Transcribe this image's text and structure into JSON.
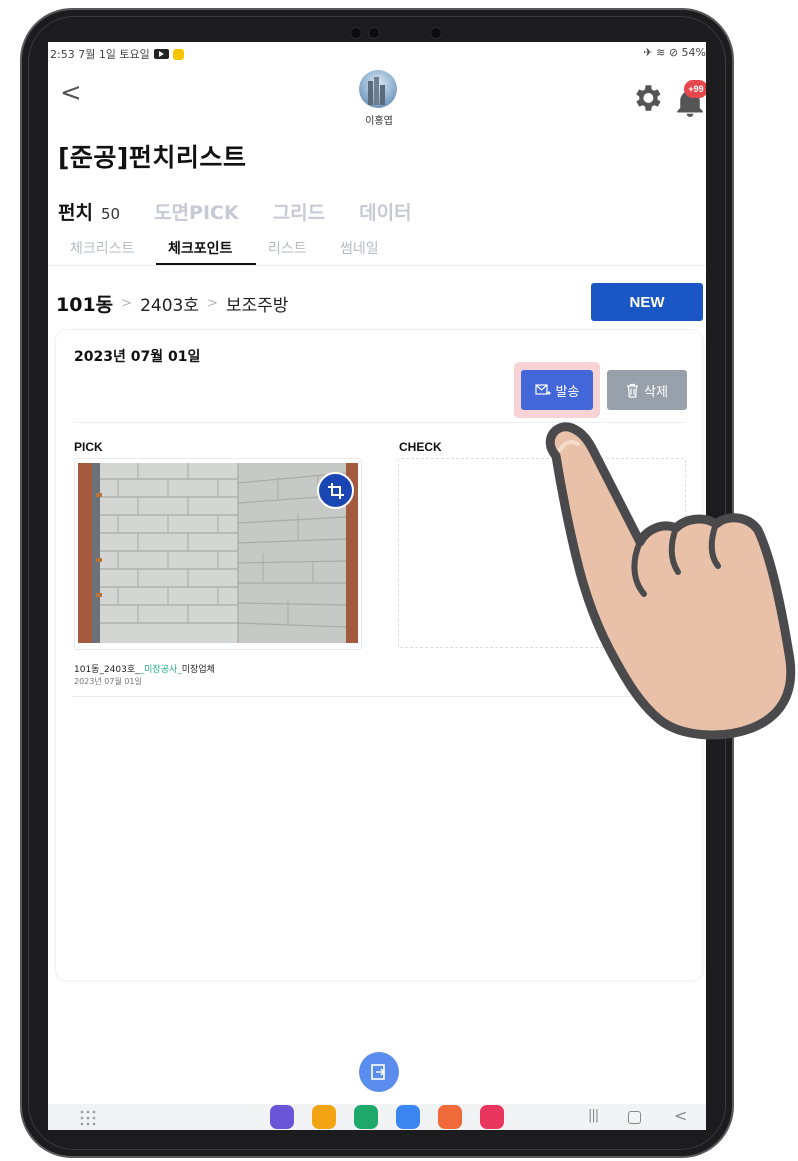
{
  "status_bar": {
    "time_date": "2:53  7월 1일 토요일",
    "right_status": "✈ ≋ ⊘ 54%"
  },
  "header": {
    "back_label": "<",
    "user_name": "이홍엽",
    "notification_badge": "+99"
  },
  "page": {
    "title": "[준공]펀치리스트"
  },
  "main_tabs": [
    {
      "label": "펀치",
      "count": "50",
      "active": true
    },
    {
      "label": "도면PICK",
      "active": false
    },
    {
      "label": "그리드",
      "active": false
    },
    {
      "label": "데이터",
      "active": false
    }
  ],
  "sub_tabs": [
    {
      "label": "체크리스트",
      "active": false
    },
    {
      "label": "체크포인트",
      "active": true
    },
    {
      "label": "리스트",
      "active": false
    },
    {
      "label": "썸네일",
      "active": false
    }
  ],
  "breadcrumb": {
    "building": "101동",
    "sep": ">",
    "unit": "2403호",
    "room": "보조주방"
  },
  "actions": {
    "new_label": "NEW"
  },
  "card": {
    "date": "2023년 07월 01일",
    "send_label": "발송",
    "delete_label": "삭제",
    "pick_label": "PICK",
    "check_label": "CHECK",
    "caption_prefix": "101동_2403호_",
    "caption_highlight": "_미장공사_",
    "caption_suffix": "미장업체",
    "photo_date": "2023년 07월 01일"
  },
  "colors": {
    "primary_blue": "#1a56c4",
    "send_blue": "#4367d8",
    "delete_gray": "#98a0ab",
    "highlight_pink": "#f7d3d5",
    "caption_green": "#23b38a"
  },
  "dock_apps": [
    {
      "name": "samsung-internet",
      "color": "#6a55d9"
    },
    {
      "name": "my-files",
      "color": "#f2a414"
    },
    {
      "name": "phone",
      "color": "#1ea86a"
    },
    {
      "name": "messages",
      "color": "#3b86f0"
    },
    {
      "name": "contacts",
      "color": "#f06a3a"
    },
    {
      "name": "camera",
      "color": "#e8365f"
    }
  ]
}
